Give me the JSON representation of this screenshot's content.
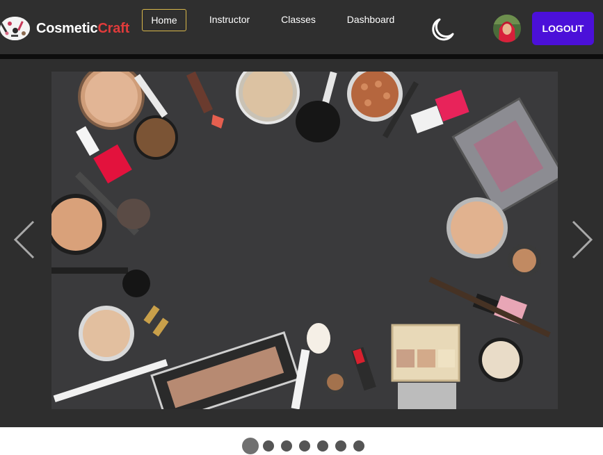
{
  "brand": {
    "name_main": "Cosmetic",
    "name_accent": "Craft"
  },
  "nav": {
    "items": [
      {
        "label": "Home",
        "active": true
      },
      {
        "label": "Instructor",
        "active": false
      },
      {
        "label": "Classes",
        "active": false
      },
      {
        "label": "Dashboard",
        "active": false
      }
    ]
  },
  "header": {
    "theme_toggle_icon": "moon-icon",
    "logout_label": "LOGOUT",
    "logout_color": "#4b10d9",
    "active_border_color": "#d9b84a"
  },
  "slider": {
    "current_slide": 1,
    "total_slides": 7,
    "prev_icon": "chevron-left-icon",
    "next_icon": "chevron-right-icon"
  }
}
